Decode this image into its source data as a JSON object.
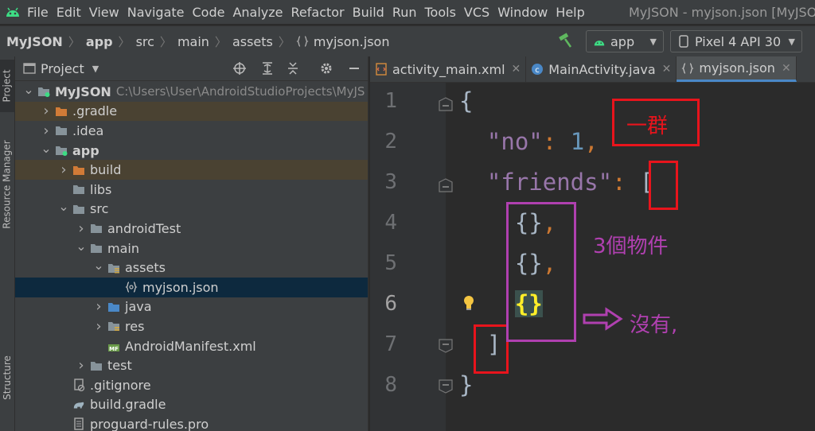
{
  "menubar": {
    "items": [
      "File",
      "Edit",
      "View",
      "Navigate",
      "Code",
      "Analyze",
      "Refactor",
      "Build",
      "Run",
      "Tools",
      "VCS",
      "Window",
      "Help"
    ],
    "window_title": "MyJSON - myjson.json [MyJSON"
  },
  "navbar": {
    "breadcrumbs": [
      "MyJSON",
      "app",
      "src",
      "main",
      "assets",
      "myjson.json"
    ],
    "run_config": "app",
    "device": "Pixel 4 API 30"
  },
  "tool_strip": {
    "project": "Project",
    "resource_manager": "Resource Manager",
    "structure": "Structure"
  },
  "project_panel": {
    "title": "Project",
    "root_path": "C:\\Users\\User\\AndroidStudioProjects\\MyJS",
    "tree": [
      {
        "label": "MyJSON",
        "level": 0,
        "arrow": "down",
        "icon": "module-folder-icon",
        "bold": true,
        "state": ""
      },
      {
        "label": ".gradle",
        "level": 1,
        "arrow": "right",
        "icon": "folder-orange-icon",
        "bold": false,
        "state": "excluded"
      },
      {
        "label": ".idea",
        "level": 1,
        "arrow": "right",
        "icon": "folder-icon",
        "bold": false,
        "state": ""
      },
      {
        "label": "app",
        "level": 1,
        "arrow": "down",
        "icon": "module-folder-icon",
        "bold": true,
        "state": ""
      },
      {
        "label": "build",
        "level": 2,
        "arrow": "right",
        "icon": "folder-orange-icon",
        "bold": false,
        "state": "excluded"
      },
      {
        "label": "libs",
        "level": 2,
        "arrow": "",
        "icon": "folder-icon",
        "bold": false,
        "state": ""
      },
      {
        "label": "src",
        "level": 2,
        "arrow": "down",
        "icon": "folder-icon",
        "bold": false,
        "state": ""
      },
      {
        "label": "androidTest",
        "level": 3,
        "arrow": "right",
        "icon": "folder-icon",
        "bold": false,
        "state": ""
      },
      {
        "label": "main",
        "level": 3,
        "arrow": "down",
        "icon": "folder-icon",
        "bold": false,
        "state": ""
      },
      {
        "label": "assets",
        "level": 4,
        "arrow": "down",
        "icon": "assets-folder-icon",
        "bold": false,
        "state": ""
      },
      {
        "label": "myjson.json",
        "level": 5,
        "arrow": "",
        "icon": "json-file-icon",
        "bold": false,
        "state": "selected"
      },
      {
        "label": "java",
        "level": 4,
        "arrow": "right",
        "icon": "source-folder-icon",
        "bold": false,
        "state": ""
      },
      {
        "label": "res",
        "level": 4,
        "arrow": "right",
        "icon": "res-folder-icon",
        "bold": false,
        "state": ""
      },
      {
        "label": "AndroidManifest.xml",
        "level": 4,
        "arrow": "",
        "icon": "manifest-file-icon",
        "bold": false,
        "state": ""
      },
      {
        "label": "test",
        "level": 3,
        "arrow": "right",
        "icon": "folder-icon",
        "bold": false,
        "state": ""
      },
      {
        "label": ".gitignore",
        "level": 2,
        "arrow": "",
        "icon": "gitignore-file-icon",
        "bold": false,
        "state": ""
      },
      {
        "label": "build.gradle",
        "level": 2,
        "arrow": "",
        "icon": "gradle-file-icon",
        "bold": false,
        "state": ""
      },
      {
        "label": "proguard-rules.pro",
        "level": 2,
        "arrow": "",
        "icon": "text-file-icon",
        "bold": false,
        "state": ""
      }
    ]
  },
  "editor_tabs": [
    {
      "label": "activity_main.xml",
      "icon": "xml-file-icon",
      "active": false
    },
    {
      "label": "MainActivity.java",
      "icon": "class-icon",
      "active": false
    },
    {
      "label": "myjson.json",
      "icon": "json-file-icon",
      "active": true
    }
  ],
  "editor": {
    "line_numbers": [
      "1",
      "2",
      "3",
      "4",
      "5",
      "6",
      "7",
      "8"
    ],
    "lines": {
      "l1": "{",
      "l2_key": "\"no\"",
      "l2_colon": ": ",
      "l2_value": "1",
      "l2_comma": ",",
      "l3_key": "\"friends\"",
      "l3_colon": ": ",
      "l3_bracket": "[",
      "l4_obj": "{}",
      "l4_comma": ",",
      "l5_obj": "{}",
      "l5_comma": ",",
      "l6_obj": "{}",
      "l7": "]",
      "l8": "}"
    }
  },
  "annotations": {
    "group_label": "一群",
    "objects_label": "3個物件",
    "arrow_label": "沒有,",
    "red_color": "#e8141c",
    "purple_color": "#b040b0"
  }
}
